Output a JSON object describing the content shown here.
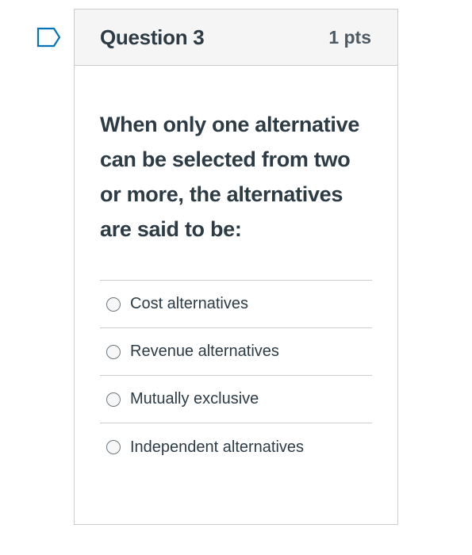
{
  "question": {
    "title": "Question 3",
    "points": "1 pts",
    "text": "When only one alternative can be selected from two or more, the alternatives are said to be:",
    "flag_icon": "bookmark-flag-icon"
  },
  "answers": [
    {
      "label": "Cost alternatives",
      "selected": false
    },
    {
      "label": "Revenue alternatives",
      "selected": false
    },
    {
      "label": "Mutually exclusive",
      "selected": false
    },
    {
      "label": "Independent alternatives",
      "selected": false
    }
  ],
  "colors": {
    "border": "#c7cdd1",
    "header_bg": "#f5f5f5",
    "text": "#2d3b45",
    "flag": "#0374b5"
  }
}
